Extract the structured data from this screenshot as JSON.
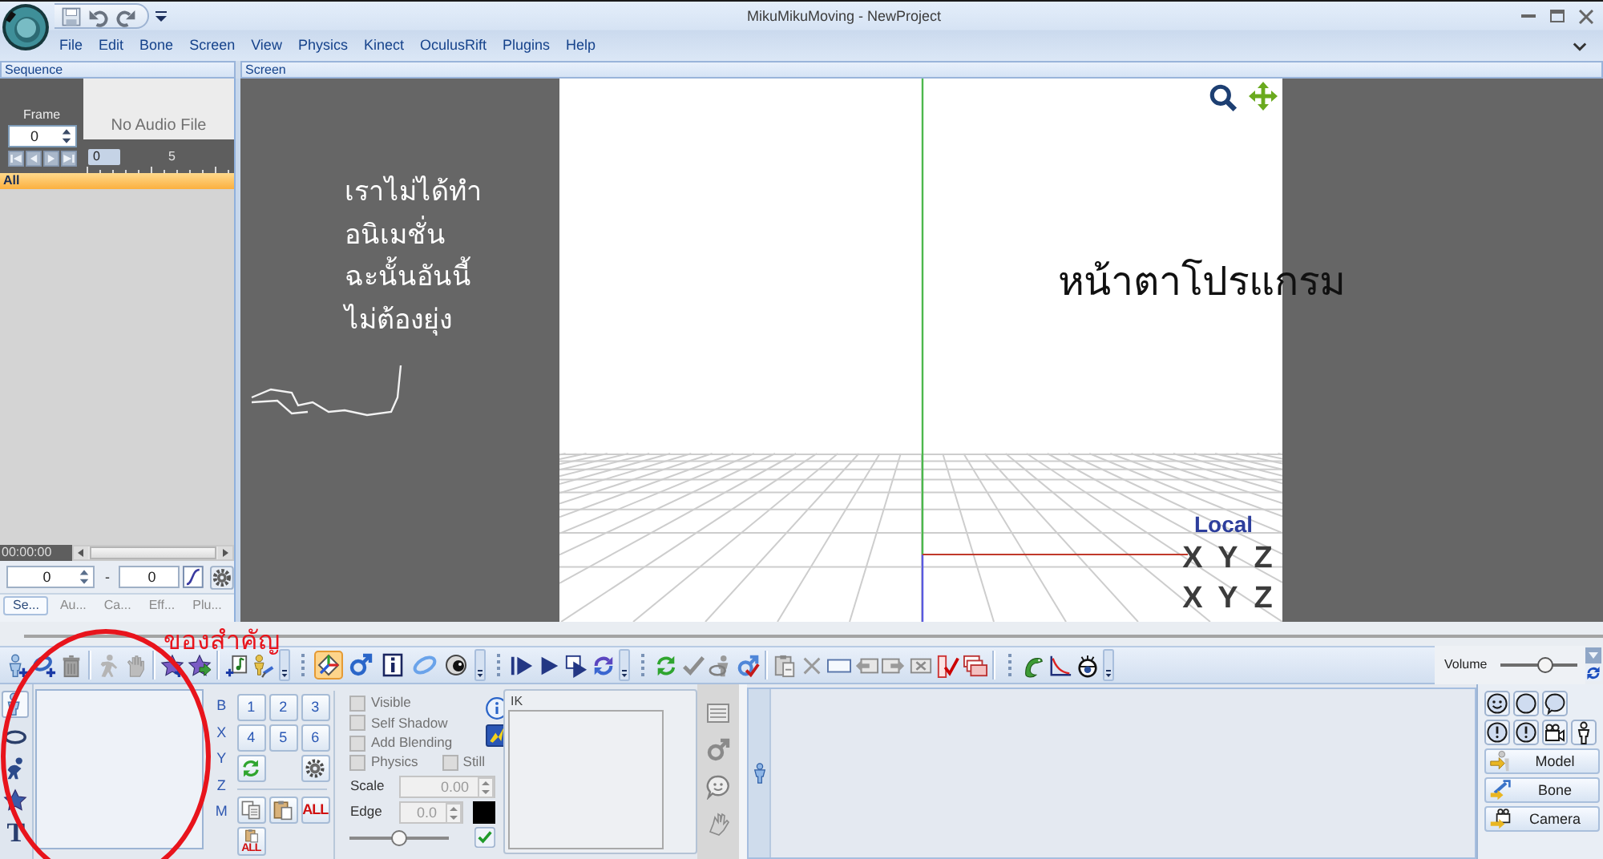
{
  "window": {
    "title": "MikuMikuMoving - NewProject"
  },
  "menu": [
    "File",
    "Edit",
    "Bone",
    "Screen",
    "View",
    "Physics",
    "Kinect",
    "OculusRift",
    "Plugins",
    "Help"
  ],
  "sequence": {
    "title": "Sequence",
    "frame_label": "Frame",
    "frame": "0",
    "audio": "No Audio File",
    "ruler": [
      "0",
      "5"
    ],
    "track": "All",
    "time": "00:00:00",
    "range_start": "0",
    "range_separator": "-",
    "range_end": "0",
    "tabs": [
      {
        "label": "Se...",
        "selected": true
      },
      {
        "label": "Au...",
        "selected": false
      },
      {
        "label": "Ca...",
        "selected": false
      },
      {
        "label": "Eff...",
        "selected": false
      },
      {
        "label": "Plu...",
        "selected": false
      }
    ]
  },
  "screen": {
    "title": "Screen",
    "note_lines": [
      "เราไม่ได้ทำ",
      "อนิเมชั่น",
      "ฉะนั้นอันนี้",
      "ไม่ต้องยุ่ง"
    ],
    "caption": "หน้าตาโปรแกรม",
    "mode": "Local",
    "gizmo_rows": [
      [
        "X",
        "Y",
        "Z"
      ],
      [
        "X",
        "Y",
        "Z"
      ]
    ]
  },
  "important_note": "ของสำคัญ",
  "toolbar": {
    "view_toggles": [
      {
        "selected": true
      },
      {
        "selected": false
      },
      {
        "selected": false
      },
      {
        "selected": false
      },
      {
        "selected": false
      }
    ],
    "volume_label": "Volume",
    "volume": {
      "level": 0.58
    }
  },
  "model_panel": {
    "tool_tabs": [
      {
        "selected": true
      },
      {
        "selected": false
      },
      {
        "selected": false
      },
      {
        "selected": false
      },
      {
        "label": "T",
        "selected": false
      }
    ],
    "axis_labels": [
      "B",
      "X",
      "Y",
      "Z",
      "M"
    ],
    "number_buttons": [
      "1",
      "2",
      "3",
      "4",
      "5",
      "6"
    ],
    "all_buttons": [
      "ALL",
      "ALL"
    ]
  },
  "properties": {
    "option_rows": [
      [
        {
          "label": "Visible",
          "checked": false,
          "disabled": true
        }
      ],
      [
        {
          "label": "Self Shadow",
          "checked": false,
          "disabled": true
        }
      ],
      [
        {
          "label": "Add Blending",
          "checked": false,
          "disabled": true
        }
      ],
      [
        {
          "label": "Physics",
          "checked": false,
          "disabled": true
        },
        {
          "label": "Still",
          "checked": false,
          "disabled": true
        }
      ]
    ],
    "scale_label": "Scale",
    "scale": "0.00",
    "edge_label": "Edge",
    "edge": "0.0",
    "slider": {
      "level": 0.5
    },
    "ik_label": "IK"
  },
  "mode_buttons": [
    "Model",
    "Bone",
    "Camera"
  ]
}
